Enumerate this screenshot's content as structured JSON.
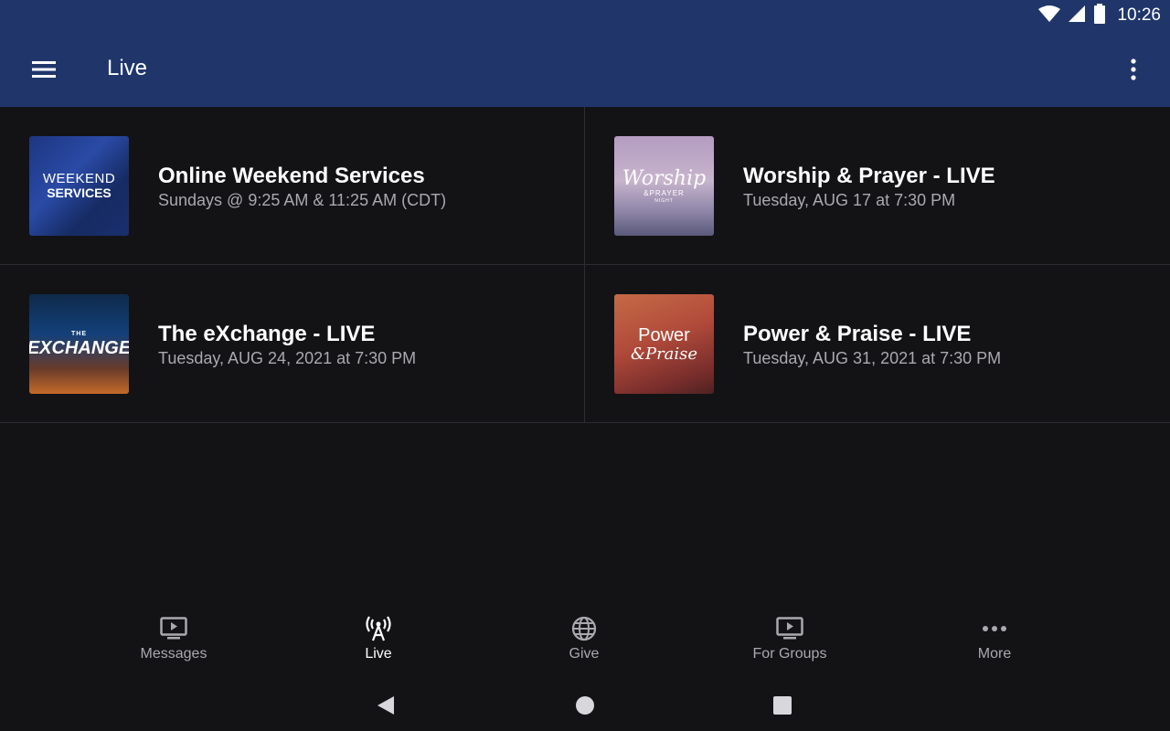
{
  "status_bar": {
    "time": "10:26",
    "icons": [
      "wifi-icon",
      "cell-signal-icon",
      "battery-icon"
    ]
  },
  "app_bar": {
    "title": "Live",
    "menu_icon": "hamburger-menu-icon",
    "overflow_icon": "more-vert-icon",
    "background": "#20366b"
  },
  "live_items": [
    {
      "title": "Online Weekend Services",
      "subtitle": "Sundays @ 9:25 AM & 11:25 AM (CDT)",
      "thumb_lines": [
        "WEEKEND",
        "SERVICES"
      ]
    },
    {
      "title": "Worship & Prayer - LIVE",
      "subtitle": "Tuesday, AUG 17 at 7:30 PM",
      "thumb_lines": [
        "Worship",
        "&PRAYER",
        "NIGHT"
      ]
    },
    {
      "title": "The eXchange - LIVE",
      "subtitle": "Tuesday, AUG 24, 2021 at 7:30 PM",
      "thumb_lines": [
        "THE",
        "EXCHANGE"
      ]
    },
    {
      "title": "Power & Praise - LIVE",
      "subtitle": "Tuesday, AUG 31, 2021 at 7:30 PM",
      "thumb_lines": [
        "Power",
        "&Praise"
      ]
    }
  ],
  "bottom_nav": [
    {
      "label": "Messages",
      "icon": "tv-play-icon",
      "active": false
    },
    {
      "label": "Live",
      "icon": "broadcast-antenna-icon",
      "active": true
    },
    {
      "label": "Give",
      "icon": "globe-icon",
      "active": false
    },
    {
      "label": "For Groups",
      "icon": "tv-play-icon",
      "active": false
    },
    {
      "label": "More",
      "icon": "more-horiz-icon",
      "active": false
    }
  ],
  "system_nav": [
    "back-icon",
    "home-icon",
    "recents-icon"
  ],
  "colors": {
    "background": "#131316",
    "divider": "#2c2c31",
    "secondary_text": "#a9a9ae",
    "active_nav": "#ffffff"
  }
}
